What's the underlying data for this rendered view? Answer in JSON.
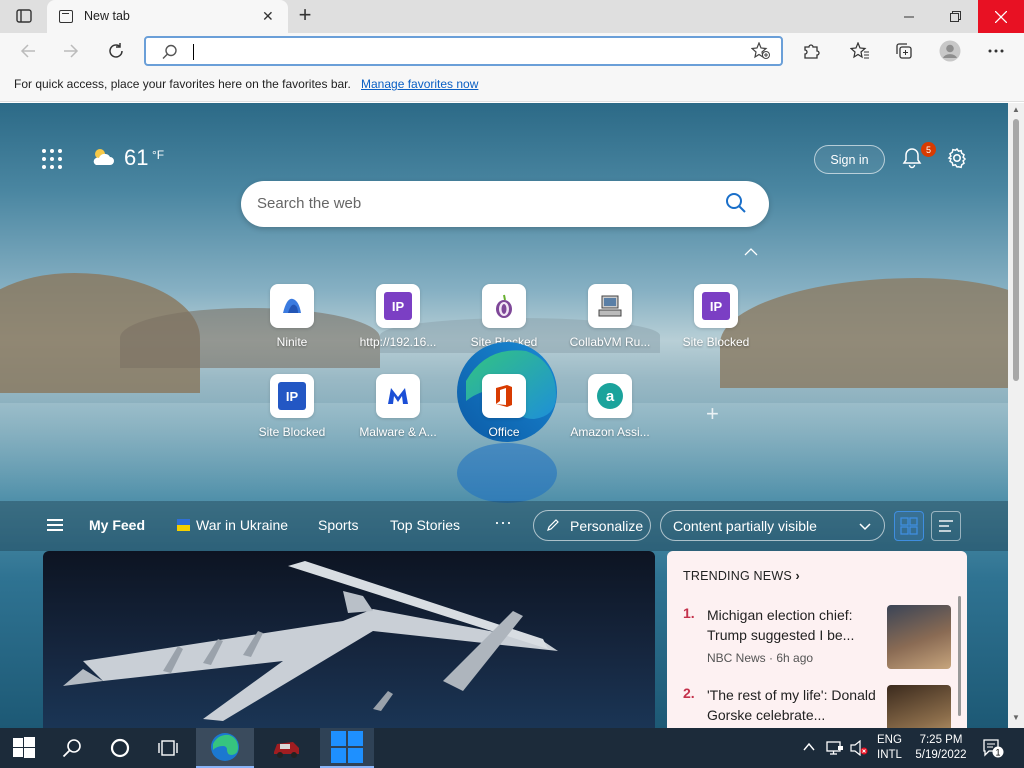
{
  "browser": {
    "tab_title": "New tab",
    "favorites_bar": {
      "message": "For quick access, place your favorites here on the favorites bar.",
      "link": "Manage favorites now"
    },
    "address_value": ""
  },
  "page": {
    "weather": {
      "temp": "61",
      "unit": "°F"
    },
    "sign_in": "Sign in",
    "notifications_count": "5",
    "search_placeholder": "Search the web",
    "quick_links": [
      {
        "label": "Ninite",
        "icon": "ninite-icon"
      },
      {
        "label": "http://192.16...",
        "icon": "ip-icon"
      },
      {
        "label": "Site Blocked",
        "icon": "tor-icon"
      },
      {
        "label": "CollabVM Ru...",
        "icon": "computer-icon"
      },
      {
        "label": "Site Blocked",
        "icon": "ip-icon"
      },
      {
        "label": "Site Blocked",
        "icon": "ip-icon"
      },
      {
        "label": "Malware & A...",
        "icon": "malwarebytes-icon"
      },
      {
        "label": "Office",
        "icon": "office-icon"
      },
      {
        "label": "Amazon Assi...",
        "icon": "amazon-assistant-icon"
      }
    ],
    "feed_nav": {
      "my_feed": "My Feed",
      "war": "War in Ukraine",
      "sports": "Sports",
      "top_stories": "Top Stories",
      "more": "···",
      "personalize": "Personalize",
      "content_select": "Content partially visible"
    },
    "trending": {
      "header": "TRENDING NEWS",
      "items": [
        {
          "num": "1.",
          "title": "Michigan election chief: Trump suggested I be...",
          "source": "NBC News · 6h ago"
        },
        {
          "num": "2.",
          "title": "'The rest of my life': Donald Gorske celebrate...",
          "source": ""
        }
      ]
    }
  },
  "taskbar": {
    "lang_top": "ENG",
    "lang_bottom": "INTL",
    "time": "7:25 PM",
    "date": "5/19/2022",
    "notif_count": "1"
  },
  "colors": {
    "close_red": "#e81123",
    "link_blue": "#0a5fc4",
    "taskbar": "#1c2b3a",
    "trending_bg": "#fdf1f2"
  }
}
